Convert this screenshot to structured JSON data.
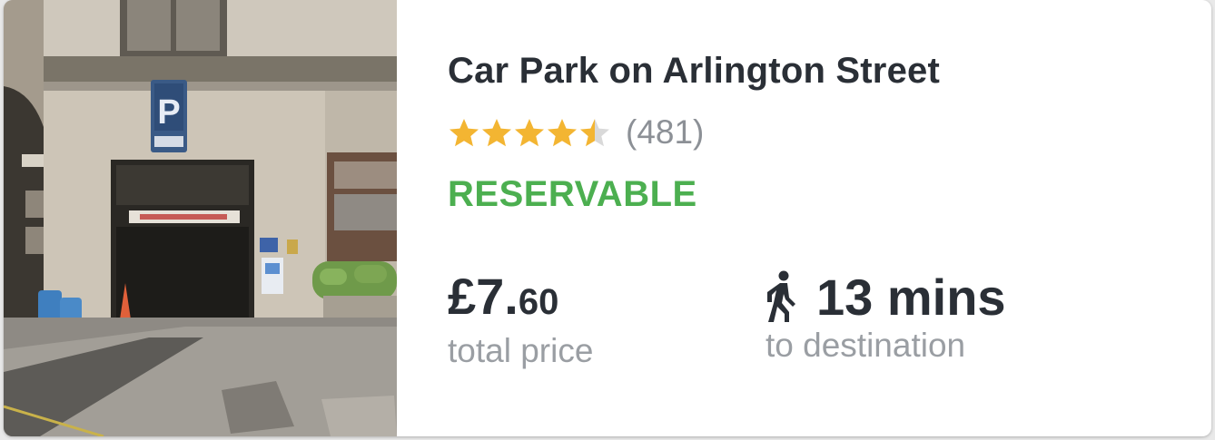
{
  "car_park": {
    "name": "Car Park on Arlington Street",
    "rating": 4.5,
    "rating_max": 5,
    "review_count": "(481)",
    "status": "RESERVABLE",
    "price_main": "£7.",
    "price_pence": "60",
    "price_label": "total price",
    "walk_time": "13 mins",
    "walk_label": "to destination"
  },
  "colors": {
    "star_filled": "#f3b532",
    "star_empty": "#d9d9d9",
    "status": "#4caf50",
    "primary_text": "#2a2f36",
    "secondary_text": "#9a9ea3"
  },
  "icons": {
    "rating": "star-icon",
    "walk": "walking-person-icon",
    "parking_sign": "parking-sign-icon"
  }
}
